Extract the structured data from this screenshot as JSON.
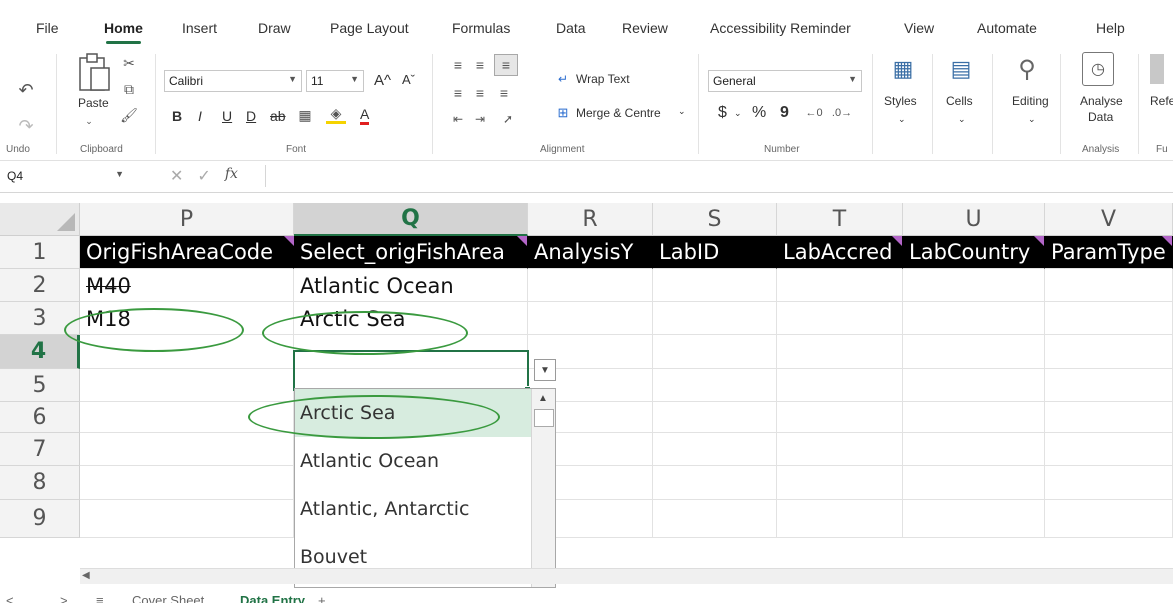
{
  "tabs": [
    "File",
    "Home",
    "Insert",
    "Draw",
    "Page Layout",
    "Formulas",
    "Data",
    "Review",
    "Accessibility Reminder",
    "View",
    "Automate",
    "Help"
  ],
  "ribbon": {
    "undo_label": "Undo",
    "clipboard": {
      "paste": "Paste",
      "group": "Clipboard"
    },
    "font": {
      "name": "Calibri",
      "size": "11",
      "grow": "A^",
      "shrink": "Aˇ",
      "bold": "B",
      "italic": "I",
      "underline": "U",
      "dunder": "D",
      "strike": "ab",
      "fontcolor": "A",
      "group": "Font"
    },
    "alignment": {
      "wrap": "Wrap Text",
      "merge": "Merge & Centre",
      "group": "Alignment"
    },
    "number": {
      "format": "General",
      "currency": "$",
      "percent": "%",
      "comma": "9",
      "group": "Number"
    },
    "styles": "Styles",
    "cells": "Cells",
    "editing": "Editing",
    "analysis": {
      "button1": "Analyse",
      "button2": "Data",
      "group": "Analysis"
    },
    "cut_off": {
      "ref": "Refe",
      "fu": "Fu"
    }
  },
  "formula_bar": {
    "name_box": "Q4",
    "cancel": "✕",
    "enter": "✓",
    "fx": "fx",
    "value": ""
  },
  "columns": [
    "P",
    "Q",
    "R",
    "S",
    "T",
    "U",
    "V"
  ],
  "rows": [
    "1",
    "2",
    "3",
    "4",
    "5",
    "6",
    "7",
    "8",
    "9"
  ],
  "header_row": [
    "OrigFishAreaCode",
    "Select_origFishArea",
    "AnalysisY",
    "LabID",
    "LabAccred",
    "LabCountry",
    "ParamType"
  ],
  "cells": {
    "P2": "M40",
    "Q2": "Atlantic Ocean",
    "P3": "M18",
    "Q3": "Arctic Sea"
  },
  "dropdown": {
    "items": [
      "Arctic Sea",
      "Atlantic Ocean",
      "Atlantic, Antarctic",
      "Bouvet"
    ],
    "highlighted": "Arctic Sea"
  },
  "sheet_tabs": {
    "items": [
      "Cover Sheet",
      "Data Entry"
    ],
    "active": "Data Entry",
    "add": "+",
    "menu": "≡",
    "prev": "<",
    "next": ">"
  },
  "colors": {
    "accent": "#217346",
    "annotation": "#3a9a3f",
    "note": "#b366c8",
    "dropdown_highlight": "#d7ecdf"
  }
}
